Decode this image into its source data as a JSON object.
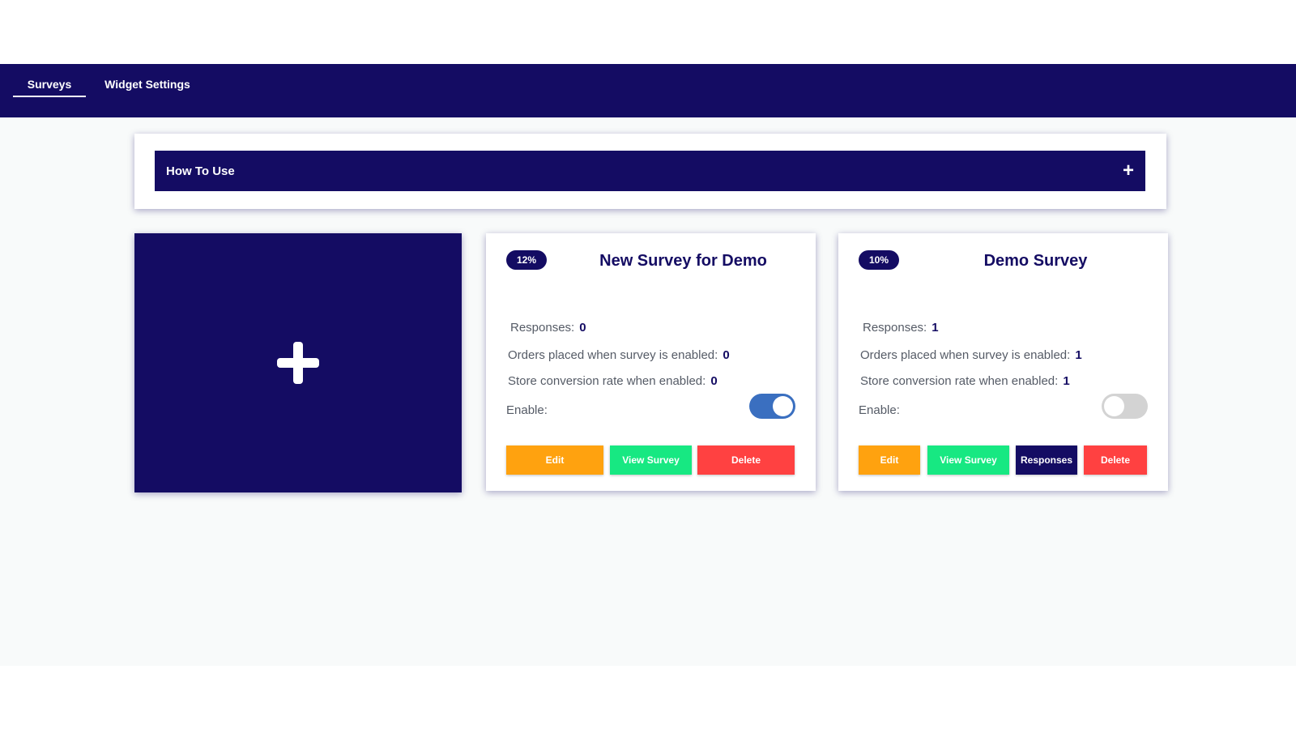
{
  "nav": {
    "tabs": [
      {
        "label": "Surveys",
        "active": true
      },
      {
        "label": "Widget Settings",
        "active": false
      }
    ]
  },
  "how_to": {
    "title": "How To Use",
    "toggle_symbol": "+"
  },
  "add_card": {
    "icon": "plus-icon"
  },
  "surveys": [
    {
      "percent": "12%",
      "title": "New Survey for Demo",
      "responses_label": "Responses:",
      "responses": "0",
      "orders_label": "Orders placed when survey is enabled:",
      "orders": "0",
      "conversion_label": "Store conversion rate when enabled:",
      "conversion": "0",
      "enable_label": "Enable:",
      "enabled": true,
      "buttons": {
        "edit": "Edit",
        "view": "View Survey",
        "delete": "Delete"
      }
    },
    {
      "percent": "10%",
      "title": "Demo Survey",
      "responses_label": "Responses:",
      "responses": "1",
      "orders_label": "Orders placed when survey is enabled:",
      "orders": "1",
      "conversion_label": "Store conversion rate when enabled:",
      "conversion": "1",
      "enable_label": "Enable:",
      "enabled": false,
      "buttons": {
        "edit": "Edit",
        "view": "View Survey",
        "responses": "Responses",
        "delete": "Delete"
      }
    }
  ],
  "colors": {
    "brand": "#140c63",
    "edit": "#ffa20f",
    "view": "#17e882",
    "delete": "#ff4141",
    "toggle_on": "#3a6fc0",
    "toggle_off": "#d3d3d3"
  }
}
